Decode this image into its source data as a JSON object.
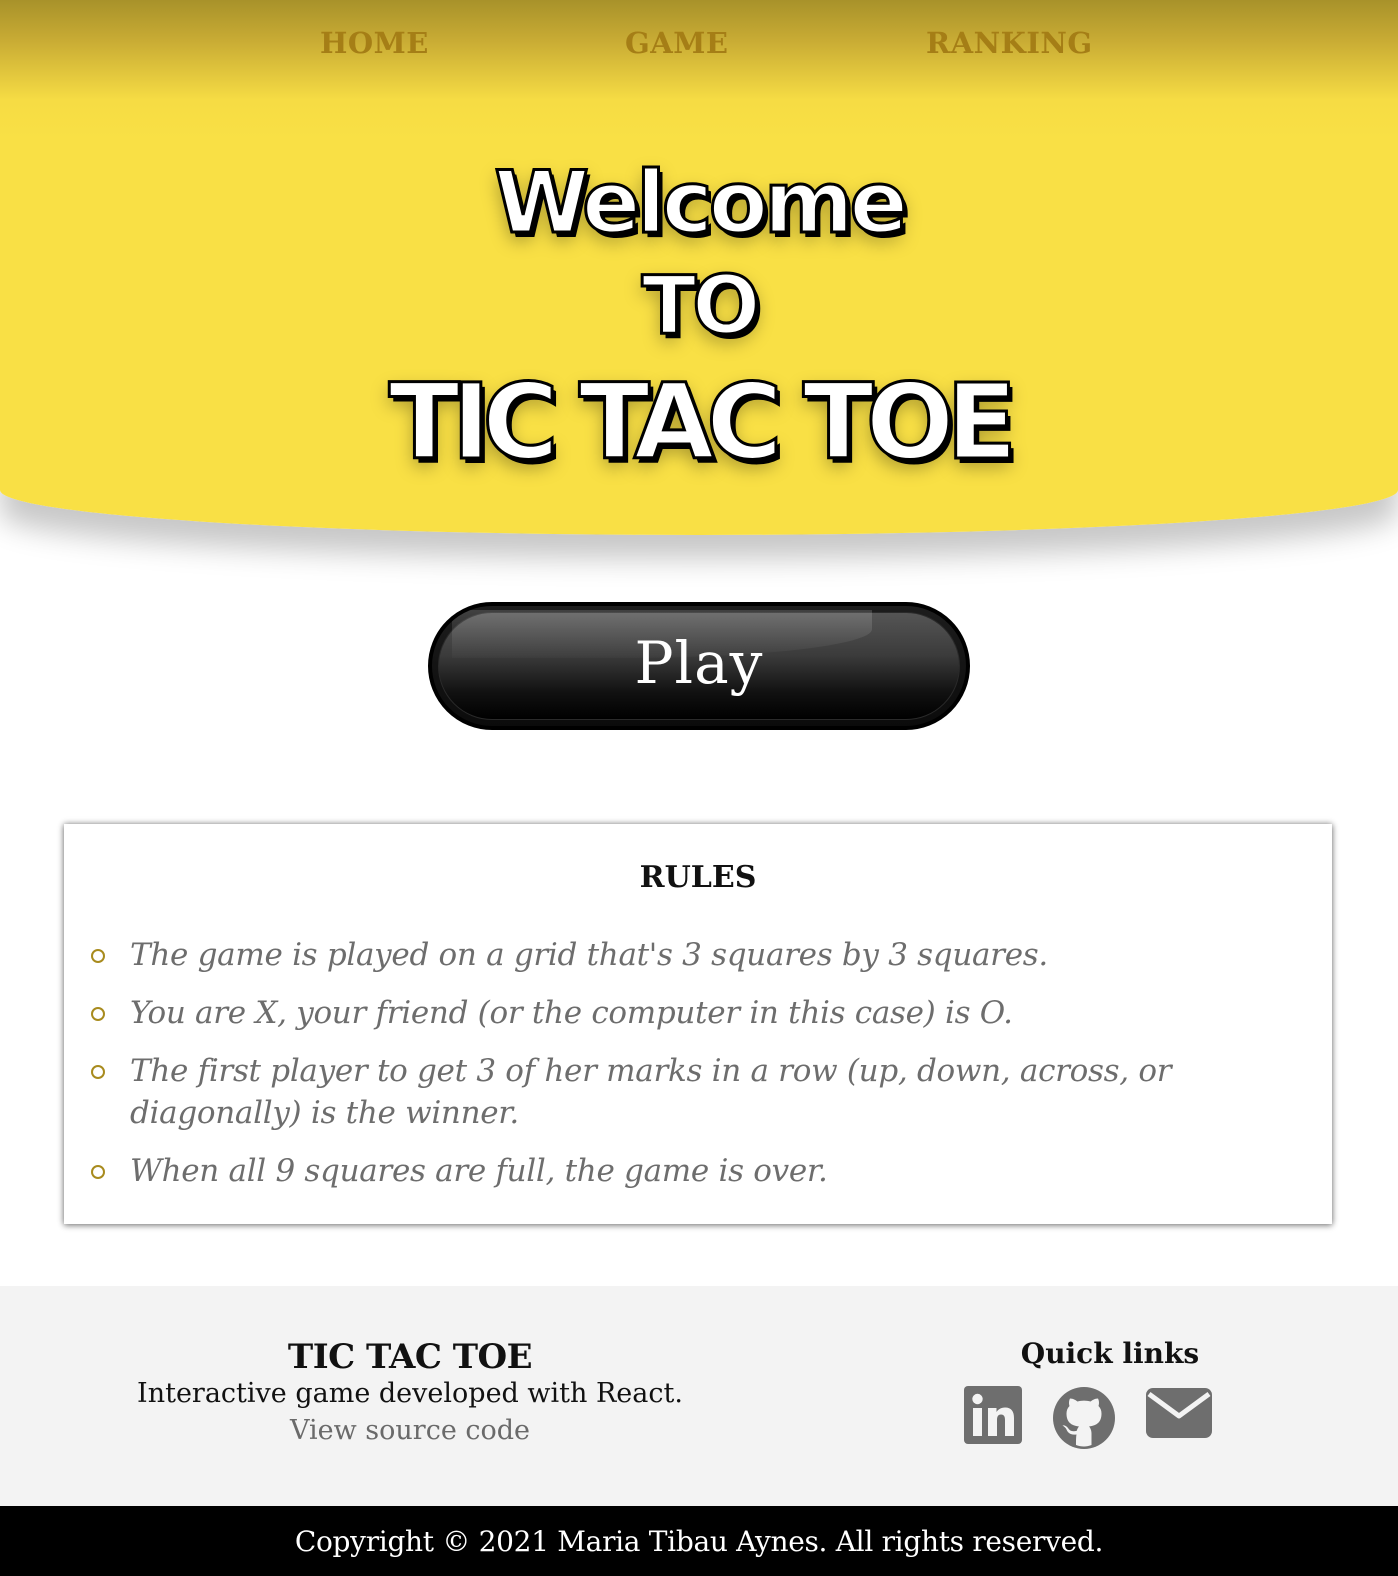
{
  "nav": {
    "home": "HOME",
    "game": "GAME",
    "ranking": "RANKING"
  },
  "hero": {
    "line1": "Welcome",
    "line2": "TO",
    "line3": "TIC TAC TOE"
  },
  "play_button": {
    "label": "Play"
  },
  "rules": {
    "title": "RULES",
    "items": [
      "The game is played on a grid that's 3 squares by 3 squares.",
      "You are X, your friend (or the computer in this case) is O.",
      "The first player to get 3 of her marks in a row (up, down, across, or diagonally) is the winner.",
      "When all 9 squares are full, the game is over."
    ]
  },
  "footer": {
    "title": "TIC TAC TOE",
    "description": "Interactive game developed with React.",
    "source_link": "View source code",
    "quick_links_title": "Quick links",
    "icons": [
      "linkedin-icon",
      "github-icon",
      "mail-icon"
    ]
  },
  "copyright": "Copyright © 2021 Maria Tibau Aynes. All rights reserved.",
  "colors": {
    "hero_yellow": "#f9e045",
    "nav_gold": "#a57e16",
    "bullet_gold": "#a88b1e",
    "footer_bg": "#f3f3f3",
    "icon_gray": "#6e6e6e"
  }
}
